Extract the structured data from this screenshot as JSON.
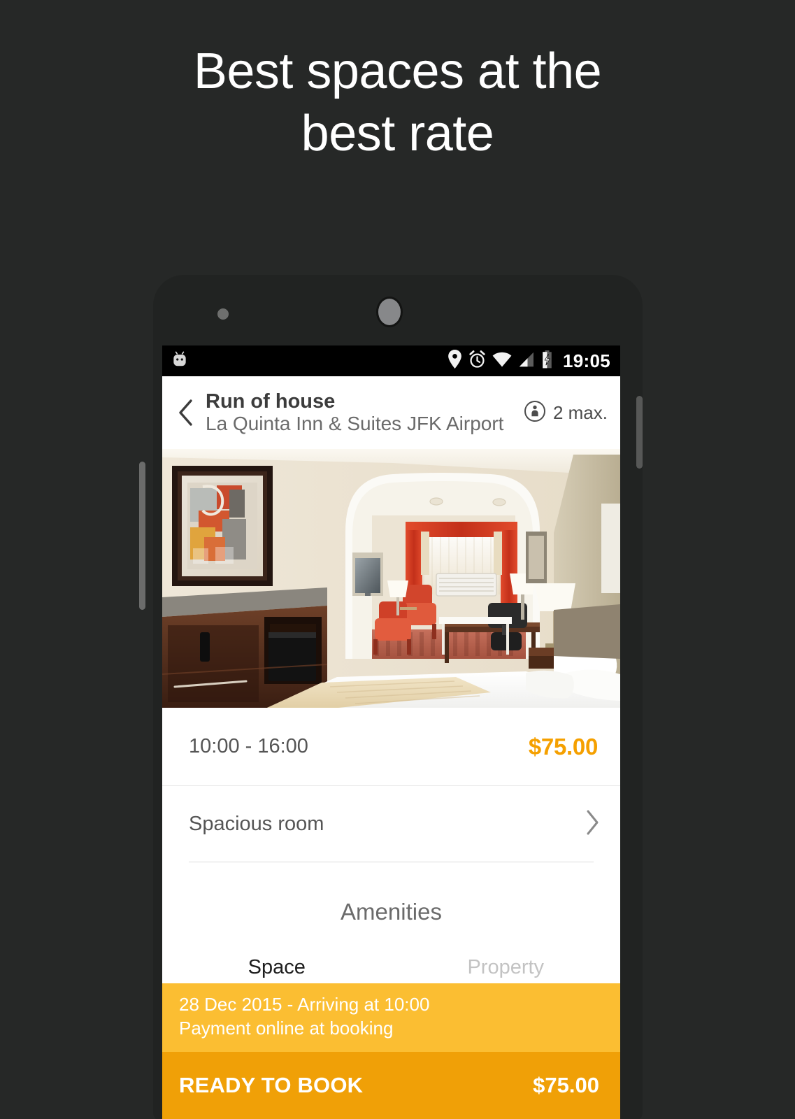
{
  "promo": {
    "headline_line1": "Best spaces at the",
    "headline_line2": "best rate"
  },
  "status_bar": {
    "time": "19:05",
    "icons": [
      "android-robot-icon",
      "location-pin-icon",
      "alarm-clock-icon",
      "wifi-icon",
      "cell-signal-icon",
      "battery-charging-icon"
    ]
  },
  "app_bar": {
    "back_icon": "chevron-left-icon",
    "title": "Run of house",
    "subtitle": "La Quinta Inn & Suites JFK Airport",
    "occupancy_icon": "person-info-circle-icon",
    "occupancy_label": "2 max."
  },
  "hero": {
    "alt": "hotel-room-photo"
  },
  "price_row": {
    "time_range": "10:00 - 16:00",
    "price": "$75.00"
  },
  "room_row": {
    "label": "Spacious room",
    "chevron_icon": "chevron-right-icon"
  },
  "amenities": {
    "title": "Amenities",
    "tabs": [
      {
        "label": "Space",
        "active": true
      },
      {
        "label": "Property",
        "active": false
      }
    ]
  },
  "booking_bar": {
    "date_line": "28 Dec 2015  - Arriving at 10:00",
    "payment_line": "Payment online at booking",
    "cta_label": "READY TO BOOK",
    "total": "$75.00"
  },
  "colors": {
    "background": "#262827",
    "phone_body": "#212322",
    "accent_orange": "#F5A000",
    "info_bar": "#FBBE32",
    "book_bar": "#F0A007",
    "status_bar": "#000000"
  }
}
